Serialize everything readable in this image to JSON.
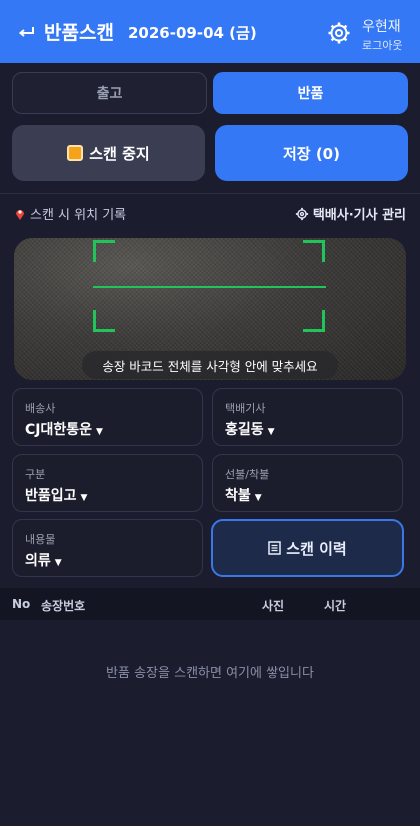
{
  "header": {
    "back_icon": "return-arrow-icon",
    "title": "반품스캔",
    "date": "2026-09-04 (금)",
    "settings_icon": "gear-icon",
    "user_name": "우현재",
    "logout_label": "로그아웃",
    "bg_color": "#3478f6"
  },
  "mode_tabs": [
    {
      "label": "출고",
      "selected": false
    },
    {
      "label": "반품",
      "selected": true
    }
  ],
  "actions": {
    "stop_scan_label": "스캔 중지",
    "stop_icon": "stop-square-icon",
    "save_label": "저장 (0)"
  },
  "location": {
    "pin_icon": "pin-icon",
    "record_label": "스캔 시 위치 기록",
    "manage_icon": "gear-icon",
    "manage_label": "택배사·기사 관리"
  },
  "camera": {
    "guide_text": "송장 바코드 전체를 사각형 안에 맞추세요",
    "frame_color": "#20c45a"
  },
  "fields": {
    "carrier": {
      "label": "배송사",
      "value": "CJ대한통운"
    },
    "driver": {
      "label": "택배기사",
      "value": "홍길동"
    },
    "category": {
      "label": "구분",
      "value": "반품입고"
    },
    "payment": {
      "label": "선불/착불",
      "value": "착불"
    },
    "contents": {
      "label": "내용물",
      "value": "의류"
    }
  },
  "history_button": {
    "label": "스캔 이력",
    "icon": "document-list-icon"
  },
  "table": {
    "columns": [
      "No",
      "송장번호",
      "사진",
      "시간"
    ],
    "empty_text": "반품 송장을 스캔하면 여기에 쌓입니다"
  }
}
